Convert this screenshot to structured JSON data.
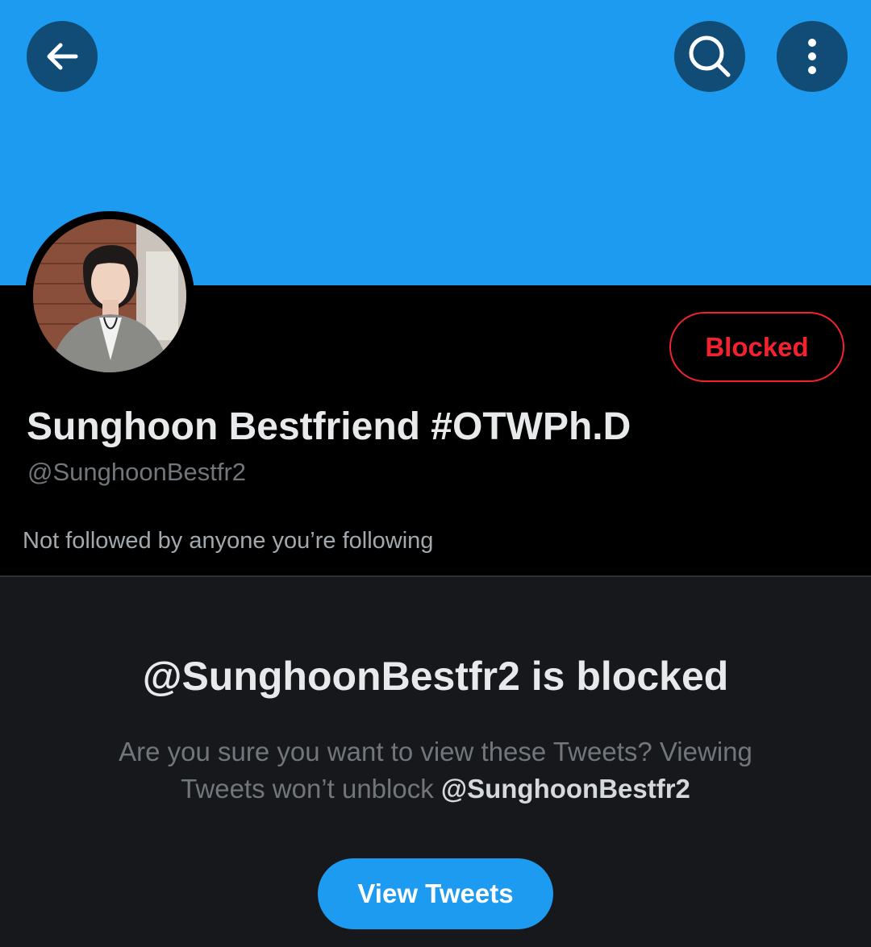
{
  "header": {
    "back_icon": "arrow-left-icon",
    "search_icon": "search-icon",
    "more_icon": "more-vertical-icon",
    "banner_color": "#1d9bf0"
  },
  "profile": {
    "display_name": "Sunghoon Bestfriend #OTWPh.D",
    "handle": "@SunghoonBestfr2",
    "followed_by": "Not followed by anyone you’re following",
    "blocked_label": "Blocked"
  },
  "blocked_notice": {
    "title": "@SunghoonBestfr2 is blocked",
    "text_before": "Are you sure you want to view these Tweets? Viewing Tweets won’t unblock ",
    "mention": "@SunghoonBestfr2",
    "button_label": "View Tweets"
  },
  "colors": {
    "accent": "#1d9bf0",
    "danger": "#f4212e",
    "background": "#000000",
    "panel": "#16181c"
  }
}
